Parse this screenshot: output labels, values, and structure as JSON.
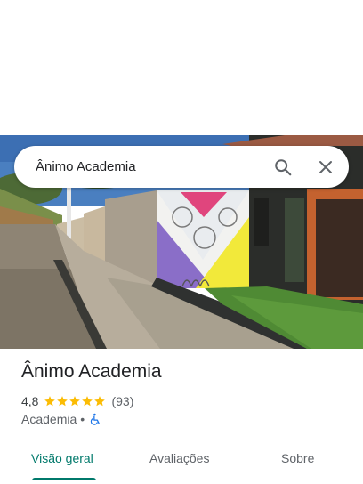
{
  "search": {
    "query": "Ânimo Academia"
  },
  "place": {
    "name": "Ânimo Academia",
    "rating": "4,8",
    "stars": 5,
    "review_count": "(93)",
    "category": "Academia",
    "separator": "•"
  },
  "tabs": [
    {
      "label": "Visão geral",
      "active": true
    },
    {
      "label": "Avaliações",
      "active": false
    },
    {
      "label": "Sobre",
      "active": false
    }
  ],
  "colors": {
    "accent": "#00796b",
    "star": "#fbbc04",
    "accessibility": "#1a73e8"
  }
}
